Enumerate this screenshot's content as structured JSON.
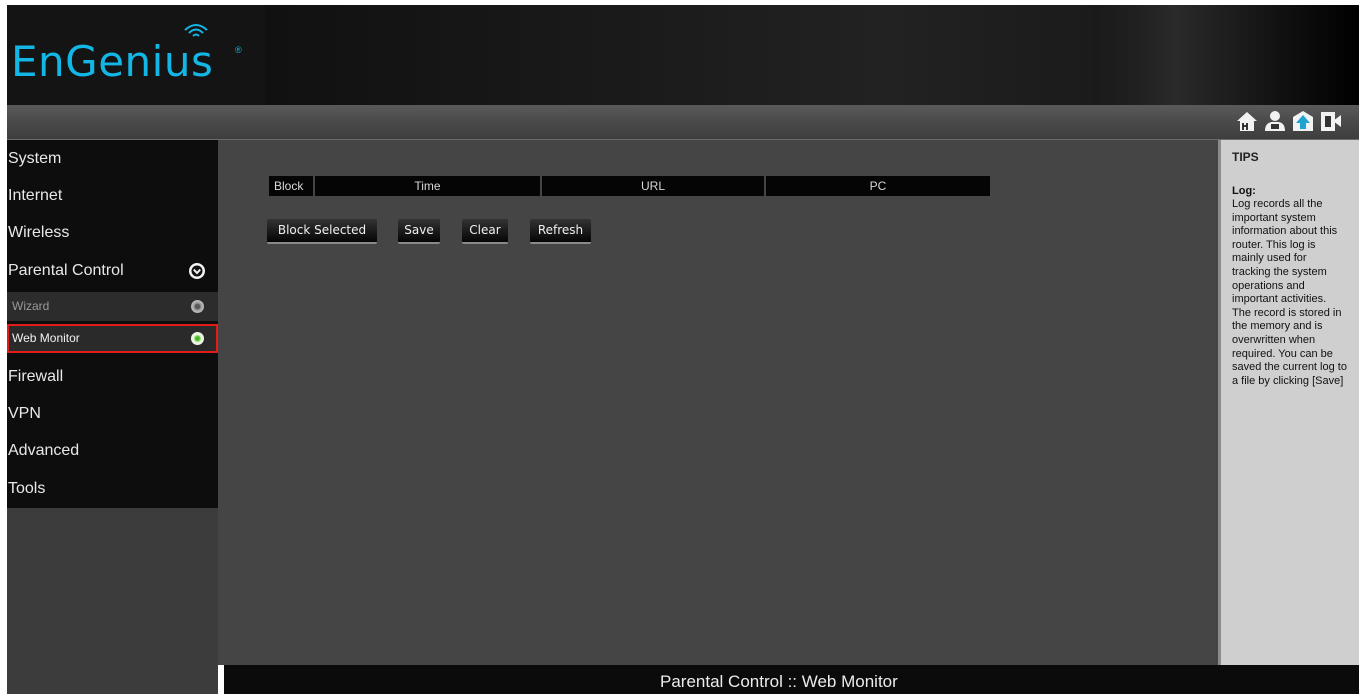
{
  "brand": {
    "name": "EnGenius",
    "registered_mark": "®",
    "color": "#13b7e5"
  },
  "toolbar": {
    "icons": [
      {
        "name": "home-icon"
      },
      {
        "name": "user-icon"
      },
      {
        "name": "firmware-upgrade-icon"
      },
      {
        "name": "logout-icon"
      }
    ]
  },
  "sidebar": {
    "items": [
      {
        "label": "System"
      },
      {
        "label": "Internet"
      },
      {
        "label": "Wireless"
      },
      {
        "label": "Parental Control",
        "expanded": true
      },
      {
        "label": "Firewall"
      },
      {
        "label": "VPN"
      },
      {
        "label": "Advanced"
      },
      {
        "label": "Tools"
      }
    ],
    "parental_control_subitems": [
      {
        "label": "Wizard",
        "selected": false
      },
      {
        "label": "Web Monitor",
        "selected": true
      }
    ]
  },
  "main": {
    "table_headers": [
      "Block",
      "Time",
      "URL",
      "PC"
    ],
    "buttons": {
      "block_selected": "Block Selected",
      "save": "Save",
      "clear": "Clear",
      "refresh": "Refresh"
    }
  },
  "tips": {
    "title": "TIPS",
    "heading": "Log:",
    "text": "Log records all the\nimportant system\ninformation about this\nrouter. This log is\nmainly used for\ntracking the system\noperations and\nimportant activities.\nThe record is stored in\nthe memory and is\noverwritten when\nrequired. You can be\nsaved the current log to\na file by clicking [Save]"
  },
  "footer": {
    "page_title": "Parental Control :: Web Monitor"
  },
  "colors": {
    "highlight_border": "#e21b1b",
    "active_dot": "#72d64a"
  }
}
